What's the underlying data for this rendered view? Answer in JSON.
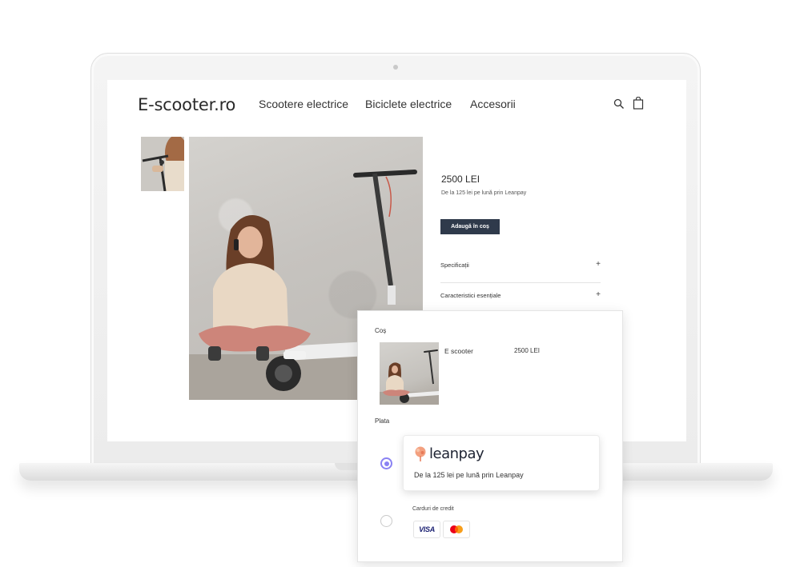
{
  "site": {
    "logo": "E-scooter.ro",
    "nav": [
      "Scootere electrice",
      "Biciclete electrice",
      "Accesorii"
    ]
  },
  "product": {
    "price": "2500 LEI",
    "installment": "De la 125 lei pe lună prin Leanpay",
    "add_to_cart": "Adaugă în coș",
    "accordion": [
      "Specificații",
      "Caracteristici esențiale"
    ]
  },
  "cart": {
    "title": "Coș",
    "item_name": "E scooter",
    "item_price": "2500 LEI"
  },
  "payment": {
    "title": "Plata",
    "leanpay": {
      "brand": "leanpay",
      "text": "De la 125 lei pe lună prin Leanpay",
      "selected": true
    },
    "credit_cards": {
      "label": "Carduri de credit",
      "brands": [
        "VISA",
        "mastercard"
      ],
      "selected": false
    }
  },
  "colors": {
    "button": "#2f3a4b",
    "radio_selected": "#8a82f3",
    "leanpay_logo": "#f0906b"
  },
  "icons": [
    "search-icon",
    "shopping-bag-icon",
    "plus-icon",
    "leanpay-logo-icon",
    "visa-icon",
    "mastercard-icon"
  ]
}
